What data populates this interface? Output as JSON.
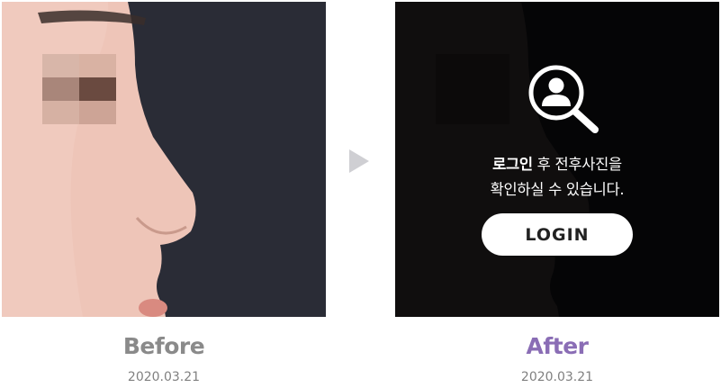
{
  "before": {
    "label": "Before",
    "date": "2020.03.21"
  },
  "after": {
    "label": "After",
    "date": "2020.03.21",
    "overlay": {
      "message_strong": "로그인",
      "message_rest": " 후 전후사진을",
      "message_line2": "확인하실 수 있습니다.",
      "login_button": "LOGIN",
      "icon": "user-search-icon"
    }
  },
  "colors": {
    "after_label": "#8a6db5",
    "before_label": "#8a8a8a",
    "date": "#808080",
    "arrow": "#cfcfd3"
  }
}
